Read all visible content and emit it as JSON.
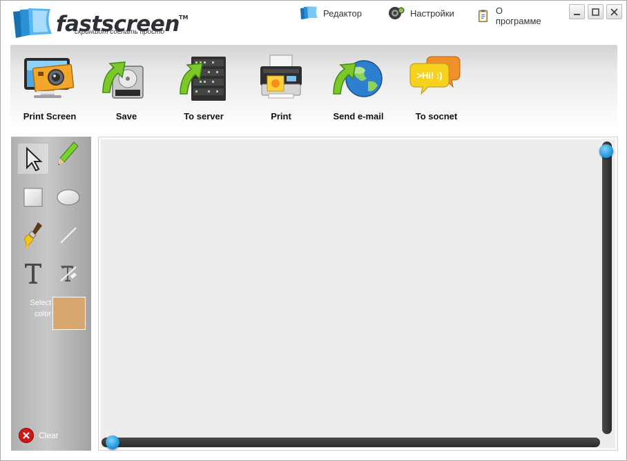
{
  "app": {
    "logo_name": "fastscreen",
    "logo_tm": "TM",
    "tagline": "скриншот сделать просто"
  },
  "topnav": {
    "editor": "Редактор",
    "settings": "Настройки",
    "about": "О программе"
  },
  "toolbar": {
    "items": [
      {
        "label": "Print Screen",
        "icon": "print-screen-icon"
      },
      {
        "label": "Save",
        "icon": "save-icon"
      },
      {
        "label": "To server",
        "icon": "server-upload-icon"
      },
      {
        "label": "Print",
        "icon": "printer-icon"
      },
      {
        "label": "Send e-mail",
        "icon": "email-globe-icon"
      },
      {
        "label": "To socnet",
        "icon": "chat-bubbles-icon"
      }
    ]
  },
  "tools": {
    "select_color_label": "Select color",
    "clear_label": "Clear",
    "current_color": "#d8a771"
  },
  "chat_icon_text": ">Hi! :)"
}
